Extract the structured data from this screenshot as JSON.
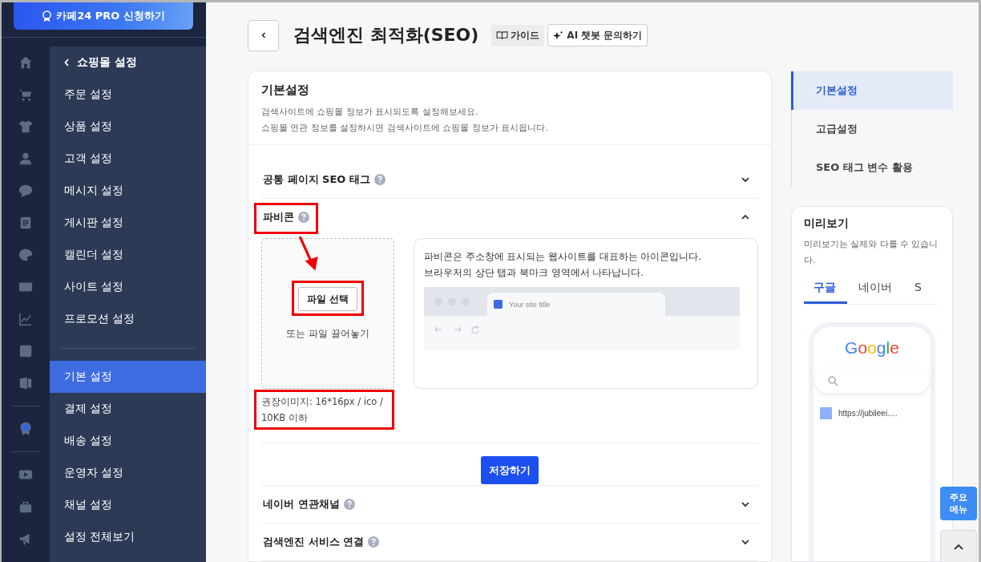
{
  "promo_button": {
    "label": "카페24 PRO 신청하기"
  },
  "sidebar": {
    "back_item": {
      "label": "쇼핑몰 설정"
    },
    "groups": [
      [
        {
          "label": "주문 설정",
          "selected": false
        },
        {
          "label": "상품 설정",
          "selected": false
        },
        {
          "label": "고객 설정",
          "selected": false
        },
        {
          "label": "메시지 설정",
          "selected": false
        },
        {
          "label": "게시판 설정",
          "selected": false
        },
        {
          "label": "캘린더 설정",
          "selected": false
        },
        {
          "label": "사이트 설정",
          "selected": false
        },
        {
          "label": "프로모션 설정",
          "selected": false
        }
      ],
      [
        {
          "label": "기본 설정",
          "selected": true
        },
        {
          "label": "결제 설정",
          "selected": false
        },
        {
          "label": "배송 설정",
          "selected": false
        },
        {
          "label": "운영자 설정",
          "selected": false
        },
        {
          "label": "채널 설정",
          "selected": false
        },
        {
          "label": "설정 전체보기",
          "selected": false
        }
      ]
    ]
  },
  "header": {
    "title": "검색엔진 최적화(SEO)",
    "guide": "가이드",
    "ai_button": "AI 챗봇 문의하기"
  },
  "card": {
    "title": "기본설정",
    "description": [
      "검색사이트에 쇼핑몰 정보가 표시되도록 설정해보세요.",
      "쇼핑몰 연관 정보를 설정하시면 검색사이트에 쇼핑몰 정보가 표시됩니다."
    ],
    "sections": [
      {
        "title": "공통 페이지 SEO 태그",
        "expanded": false
      },
      {
        "title": "파비콘",
        "expanded": true,
        "body": {
          "file_button": "파일 선택",
          "drop_hint": "또는 파일 끌어놓기",
          "info": [
            "파비콘은 주소창에 표시되는 웹사이트를 대표하는 아이콘입니다.",
            "브라우저의 상단 탭과 북마크 영역에서 나타납니다."
          ],
          "tab_title": "Your site title",
          "recommendation": "권장이미지: 16*16px / ico / 10KB 이하",
          "save_button": "저장하기"
        }
      },
      {
        "title": "네이버 연관채널",
        "expanded": false
      },
      {
        "title": "검색엔진 서비스 연결",
        "expanded": false
      }
    ]
  },
  "right_nav": [
    {
      "label": "기본설정",
      "selected": true
    },
    {
      "label": "고급설정",
      "selected": false
    },
    {
      "label": "SEO 태그 변수 활용",
      "selected": false
    }
  ],
  "preview": {
    "title": "미리보기",
    "description": "미리보기는 실제와 다를 수 있습니다.",
    "tabs": [
      {
        "label": "구글",
        "selected": true
      },
      {
        "label": "네이버",
        "selected": false
      },
      {
        "label": "S",
        "selected": false
      }
    ],
    "logo": "Google",
    "url": "https://jubileei.…"
  },
  "floating": {
    "menu_button": "주요 메뉴"
  }
}
